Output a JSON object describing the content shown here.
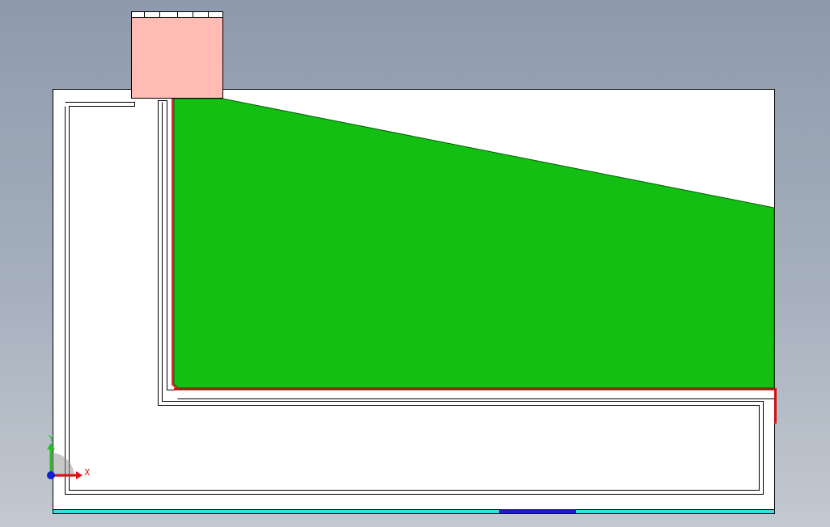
{
  "viewport": {
    "background_top": "#8e9aac",
    "background_bottom": "#c3c9d1"
  },
  "colors": {
    "frame_fill": "#ffffff",
    "frame_stroke": "#000000",
    "green_body": "#13bf13",
    "pink_block": "#ffbbb4",
    "red_edge": "#d01010",
    "cyan_base": "#33e0e6",
    "blue_base": "#1a1acc",
    "axis_x": "#e01010",
    "axis_y": "#20c020",
    "axis_origin": "#1020d0"
  },
  "triad": {
    "x_label": "X",
    "y_label": "Y",
    "x_icon": "x-axis-arrow-icon",
    "y_icon": "y-axis-arrow-icon",
    "origin_icon": "origin-dot-icon"
  }
}
